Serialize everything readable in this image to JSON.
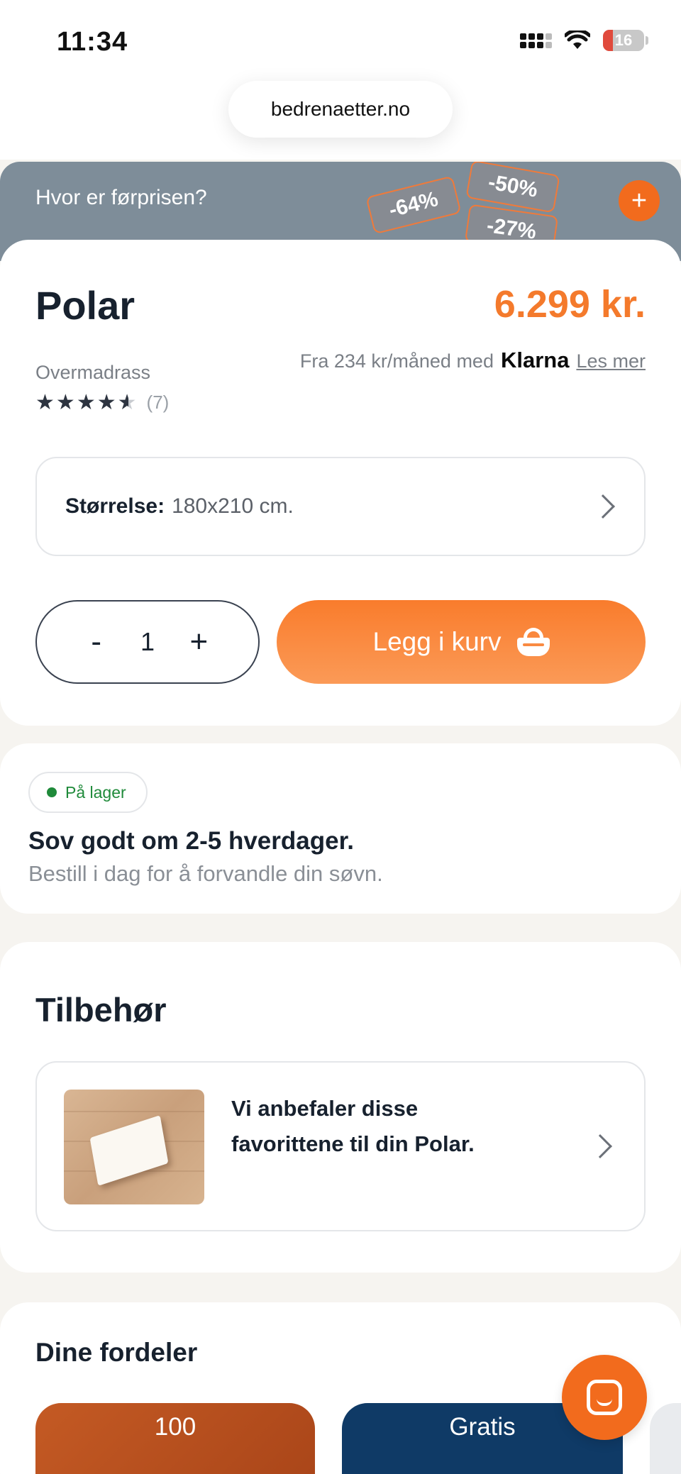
{
  "status_bar": {
    "time": "11:34",
    "battery": "16",
    "icons": [
      "signal-icon",
      "wifi-icon",
      "battery-icon"
    ]
  },
  "browser": {
    "url": "bedrenaetter.no"
  },
  "promo": {
    "text": "Hvor er førprisen?",
    "tags": [
      "-64%",
      "-50%",
      "-27%"
    ],
    "plus": "+"
  },
  "product": {
    "name": "Polar",
    "price": "6.299 kr.",
    "type": "Overmadrass",
    "rating_stars": 4.5,
    "review_count": "(7)",
    "financing": {
      "prefix": "Fra 234 kr/måned med",
      "provider": "Klarna",
      "link": "Les mer"
    },
    "size_label": "Størrelse:",
    "size_value": "180x210 cm.",
    "quantity": {
      "minus": "-",
      "value": "1",
      "plus": "+"
    },
    "add_to_cart": "Legg i kurv"
  },
  "stock": {
    "badge": "På lager",
    "title": "Sov godt om 2-5 hverdager.",
    "subtitle": "Bestill i dag for å forvandle din søvn."
  },
  "accessories": {
    "title": "Tilbehør",
    "recommendation": "Vi anbefaler disse favorittene til din Polar."
  },
  "benefits": {
    "title": "Dine fordeler",
    "tiles": [
      "100",
      "Gratis"
    ]
  },
  "colors": {
    "accent": "#f47a2c",
    "promo_bg": "#7e8d99",
    "navy": "#0f3a66",
    "in_stock": "#1f8a3a"
  }
}
